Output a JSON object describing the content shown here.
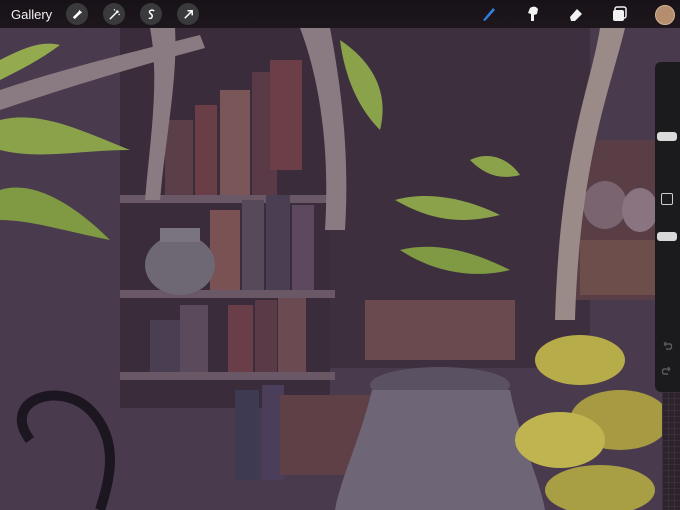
{
  "toolbar": {
    "gallery_label": "Gallery",
    "left_tools": [
      {
        "icon": "wrench-icon"
      },
      {
        "icon": "magic-wand-icon"
      },
      {
        "icon": "selection-s-icon"
      },
      {
        "icon": "transform-arrow-icon"
      }
    ],
    "right_tools": [
      {
        "icon": "brush-icon",
        "color": "#2f7fe0"
      },
      {
        "icon": "smudge-icon"
      },
      {
        "icon": "eraser-icon"
      },
      {
        "icon": "layers-icon"
      }
    ],
    "current_color": "#b48e6e"
  },
  "sidebar": {
    "brush_size_level": 0.17,
    "opacity_level": 0.5
  }
}
